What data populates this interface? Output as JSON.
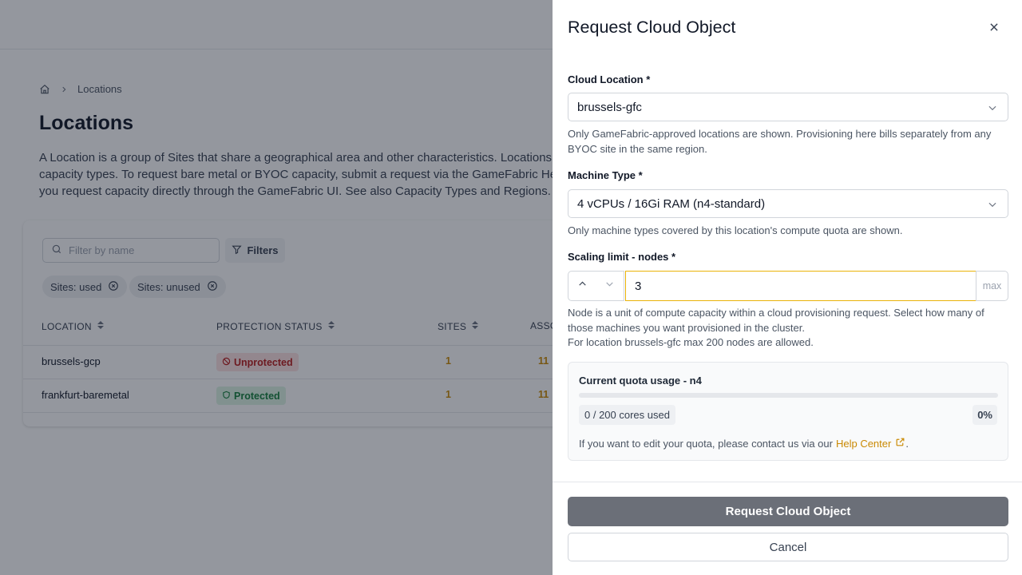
{
  "background": {
    "breadcrumb": {
      "current": "Locations"
    },
    "title": "Locations",
    "description_lines": [
      "A Location is a group of Sites that share a geographical area and other characteristics. Locations",
      "capacity types. To request bare metal or BYOC capacity, submit a request via the GameFabric He",
      "you request capacity directly through the GameFabric UI. See also Capacity Types and Regions."
    ],
    "search_placeholder": "Filter by name",
    "filters_label": "Filters",
    "chips": [
      "Sites: used",
      "Sites: unused"
    ],
    "columns": [
      "LOCATION",
      "PROTECTION STATUS",
      "SITES",
      "ASSO"
    ],
    "rows": [
      {
        "location": "brussels-gcp",
        "status": "Unprotected",
        "sites": "1",
        "assoc": "11"
      },
      {
        "location": "frankfurt-baremetal",
        "status": "Protected",
        "sites": "1",
        "assoc": "11"
      }
    ],
    "colors": {
      "unprotected": "#b91c1c",
      "protected": "#15803d",
      "accent": "#ca8a04"
    }
  },
  "drawer": {
    "title": "Request Cloud Object",
    "cloud_location": {
      "label": "Cloud Location *",
      "value": "brussels-gfc",
      "hint": "Only GameFabric-approved locations are shown. Provisioning here bills separately from any BYOC site in the same region."
    },
    "machine_type": {
      "label": "Machine Type *",
      "value": "4 vCPUs / 16Gi RAM (n4-standard)",
      "hint": "Only machine types covered by this location's compute quota are shown."
    },
    "scaling_limit": {
      "label": "Scaling limit - nodes *",
      "value": "3",
      "unit": "max",
      "hint_line1": "Node is a unit of compute capacity within a cloud provisioning request. Select how many of those machines you want provisioned in the cluster.",
      "hint_line2": "For location brussels-gfc max 200 nodes are allowed."
    },
    "quota": {
      "title": "Current quota usage - n4",
      "used_label": "0 / 200 cores used",
      "percent_label": "0%",
      "percent": 0,
      "note": "If you want to edit your quota, please contact us via our",
      "link": "Help Center",
      "note_end": "."
    },
    "submit_label": "Request Cloud Object",
    "cancel_label": "Cancel",
    "accent_color": "#eab308"
  }
}
